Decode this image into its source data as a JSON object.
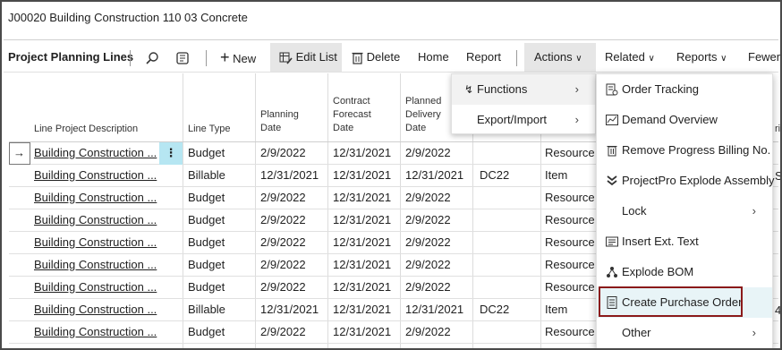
{
  "page_title": "J00020 Building Construction 110 03 Concrete",
  "toolbar": {
    "section_title": "Project Planning Lines",
    "new_label": "New",
    "edit_list_label": "Edit List",
    "delete_label": "Delete",
    "home_label": "Home",
    "report_label": "Report",
    "actions_label": "Actions",
    "related_label": "Related",
    "reports_label": "Reports",
    "fewer_label": "Fewer o"
  },
  "table": {
    "headers": {
      "description": "Line Project Description",
      "line_type": "Line Type",
      "planning_date": [
        "Planning",
        "Date"
      ],
      "contract_forecast_date": [
        "Contract",
        "Forecast",
        "Date"
      ],
      "planned_delivery_date": [
        "Planned",
        "Delivery",
        "Date"
      ]
    },
    "rows": [
      {
        "desc": "Building Construction ...",
        "type": "Budget",
        "planning": "2/9/2022",
        "contract": "12/31/2021",
        "delivery": "2/9/2022",
        "loc": "",
        "kind": "Resource"
      },
      {
        "desc": "Building Construction ...",
        "type": "Billable",
        "planning": "12/31/2021",
        "contract": "12/31/2021",
        "delivery": "12/31/2021",
        "loc": "DC22",
        "kind": "Item"
      },
      {
        "desc": "Building Construction ...",
        "type": "Budget",
        "planning": "2/9/2022",
        "contract": "12/31/2021",
        "delivery": "2/9/2022",
        "loc": "",
        "kind": "Resource"
      },
      {
        "desc": "Building Construction ...",
        "type": "Budget",
        "planning": "2/9/2022",
        "contract": "12/31/2021",
        "delivery": "2/9/2022",
        "loc": "",
        "kind": "Resource"
      },
      {
        "desc": "Building Construction ...",
        "type": "Budget",
        "planning": "2/9/2022",
        "contract": "12/31/2021",
        "delivery": "2/9/2022",
        "loc": "",
        "kind": "Resource"
      },
      {
        "desc": "Building Construction ...",
        "type": "Budget",
        "planning": "2/9/2022",
        "contract": "12/31/2021",
        "delivery": "2/9/2022",
        "loc": "",
        "kind": "Resource"
      },
      {
        "desc": "Building Construction ...",
        "type": "Budget",
        "planning": "2/9/2022",
        "contract": "12/31/2021",
        "delivery": "2/9/2022",
        "loc": "",
        "kind": "Resource"
      },
      {
        "desc": "Building Construction ...",
        "type": "Billable",
        "planning": "12/31/2021",
        "contract": "12/31/2021",
        "delivery": "12/31/2021",
        "loc": "DC22",
        "kind": "Item"
      },
      {
        "desc": "Building Construction ...",
        "type": "Budget",
        "planning": "2/9/2022",
        "contract": "12/31/2021",
        "delivery": "2/9/2022",
        "loc": "",
        "kind": "Resource"
      }
    ],
    "right_edge_fragments": {
      "header": "ri",
      "row2": "S",
      "row8": "4"
    }
  },
  "actions_menu": {
    "items": [
      {
        "label": "Functions",
        "icon": "lightning-icon"
      },
      {
        "label": "Export/Import",
        "icon": ""
      }
    ]
  },
  "functions_menu": {
    "items": [
      {
        "label": "Order Tracking",
        "icon": "order-tracking-icon"
      },
      {
        "label": "Demand Overview",
        "icon": "chart-icon"
      },
      {
        "label": "Remove Progress Billing No.",
        "icon": "trash-icon"
      },
      {
        "label": "ProjectPro Explode Assembly",
        "icon": "double-chevron-down-icon"
      },
      {
        "label": "Lock",
        "icon": ""
      },
      {
        "label": "Insert Ext. Text",
        "icon": "text-insert-icon"
      },
      {
        "label": "Explode BOM",
        "icon": "bom-icon"
      },
      {
        "label": "Create Purchase Order",
        "icon": "document-icon"
      },
      {
        "label": "Other",
        "icon": ""
      }
    ]
  }
}
